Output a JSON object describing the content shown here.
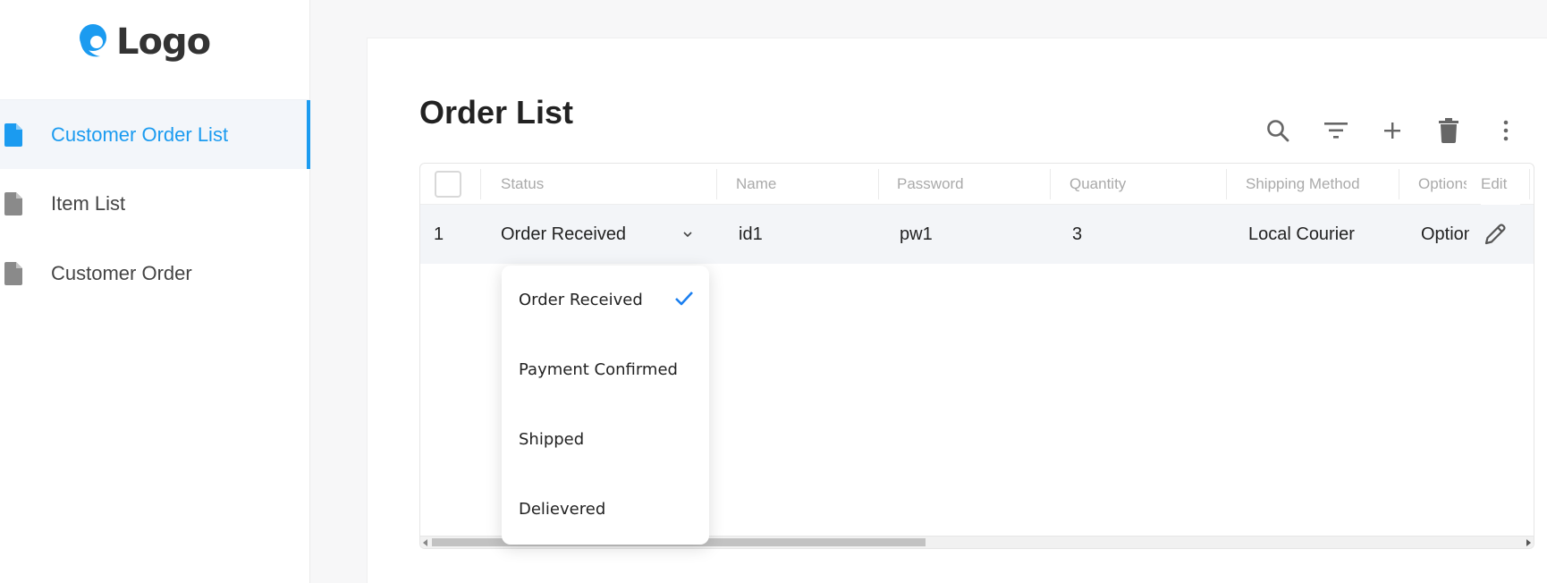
{
  "logo": {
    "text": "Logo",
    "color": "#1b9bf0"
  },
  "sidebar": {
    "items": [
      {
        "label": "Customer Order List",
        "active": true,
        "icon": "document-icon"
      },
      {
        "label": "Item List",
        "active": false,
        "icon": "document-icon"
      },
      {
        "label": "Customer Order",
        "active": false,
        "icon": "document-icon"
      }
    ]
  },
  "page": {
    "title": "Order List"
  },
  "toolbar": {
    "buttons": [
      "search-icon",
      "filter-icon",
      "add-icon",
      "delete-icon",
      "more-vert-icon"
    ]
  },
  "table": {
    "columns": [
      "Status",
      "Name",
      "Password",
      "Quantity",
      "Shipping Method",
      "Options",
      "Edit"
    ],
    "rows": [
      {
        "index": "1",
        "status": "Order Received",
        "name": "id1",
        "password": "pw1",
        "quantity": "3",
        "shipping_method": "Local Courier",
        "options": "Options"
      }
    ]
  },
  "status_dropdown": {
    "options": [
      "Order Received",
      "Payment Confirmed",
      "Shipped",
      "Delievered"
    ],
    "selected": "Order Received"
  },
  "colors": {
    "accent": "#1b9bf0",
    "check": "#1b7ff0"
  }
}
